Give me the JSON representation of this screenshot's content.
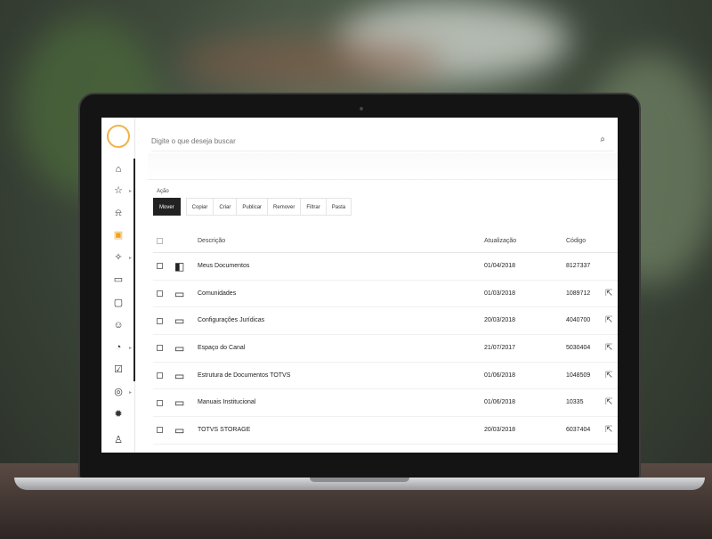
{
  "search": {
    "placeholder": "Digite o que deseja buscar"
  },
  "sidebar": {
    "items": [
      {
        "icon": "dashboard-icon",
        "glyph": "⌂"
      },
      {
        "icon": "star-icon",
        "glyph": "☆"
      },
      {
        "icon": "bell-icon",
        "glyph": "⍾"
      },
      {
        "icon": "documents-icon",
        "glyph": "▣"
      },
      {
        "icon": "activity-icon",
        "glyph": "✧"
      },
      {
        "icon": "monitor-icon",
        "glyph": "▭"
      },
      {
        "icon": "chat-icon",
        "glyph": "▢"
      },
      {
        "icon": "users-icon",
        "glyph": "☺"
      },
      {
        "icon": "shield-icon",
        "glyph": "◔"
      },
      {
        "icon": "tasks-icon",
        "glyph": "☑"
      },
      {
        "icon": "compass-icon",
        "glyph": "◎"
      },
      {
        "icon": "flame-icon",
        "glyph": "✹"
      },
      {
        "icon": "profile-icon",
        "glyph": "♙"
      }
    ]
  },
  "filter": {
    "label": "Ação",
    "chips": [
      "Mover",
      "Copiar",
      "Criar",
      "Publicar",
      "Remover",
      "Filtrar",
      "Pasta"
    ]
  },
  "table": {
    "headers": {
      "description": "Descrição",
      "updated": "Atualização",
      "code": "Código"
    },
    "rows": [
      {
        "icon": "document-icon",
        "glyph": "◧",
        "description": "Meus Documentos",
        "date": "01/04/2018",
        "code": "8127337"
      },
      {
        "icon": "folder-icon",
        "glyph": "▭",
        "description": "Comunidades",
        "date": "01/03/2018",
        "code": "1089712"
      },
      {
        "icon": "folder-icon",
        "glyph": "▭",
        "description": "Configurações Jurídicas",
        "date": "20/03/2018",
        "code": "4040700"
      },
      {
        "icon": "folder-icon",
        "glyph": "▭",
        "description": "Espaço do Canal",
        "date": "21/07/2017",
        "code": "5030404"
      },
      {
        "icon": "folder-icon",
        "glyph": "▭",
        "description": "Estrutura de Documentos TOTVS",
        "date": "01/06/2018",
        "code": "1048509"
      },
      {
        "icon": "folder-icon",
        "glyph": "▭",
        "description": "Manuais Institucional",
        "date": "01/06/2018",
        "code": "10335"
      },
      {
        "icon": "folder-icon",
        "glyph": "▭",
        "description": "TOTVS STORAGE",
        "date": "20/03/2018",
        "code": "6037404"
      }
    ]
  }
}
